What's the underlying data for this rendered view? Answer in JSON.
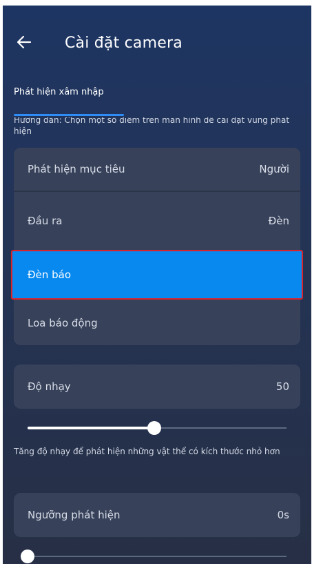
{
  "header": {
    "back_icon": "arrow-left-icon",
    "title": "Cài đặt camera"
  },
  "tab": {
    "label": "Phát hiện xâm nhập",
    "accent": "#2f8cf5"
  },
  "guide_text": "Hướng dẫn: Chọn một số điểm trên màn hình để cài đặt vùng phát hiện",
  "settings": {
    "target": {
      "label": "Phát hiện mục tiêu",
      "value": "Người"
    },
    "output": {
      "label": "Đầu ra",
      "value": "Đèn"
    },
    "options": [
      {
        "label": "Đèn báo",
        "selected": true
      },
      {
        "label": "Loa báo động",
        "selected": false
      }
    ]
  },
  "sensitivity": {
    "label": "Độ nhạy",
    "value": "50",
    "slider_fraction": 0.49,
    "note": "Tăng độ nhạy để phát hiện những vật thể có kích thước nhỏ hơn"
  },
  "threshold": {
    "label": "Ngưỡng phát hiện",
    "value": "0s",
    "slider_fraction": 0.0
  },
  "colors": {
    "selected_bg": "#0889f0",
    "highlight_border": "#d9232d",
    "card_bg": "#37425a"
  }
}
